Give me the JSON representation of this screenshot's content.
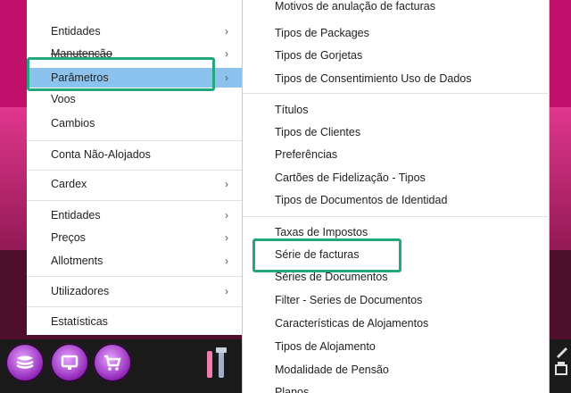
{
  "left_menu": {
    "items": [
      {
        "label": "Entidades",
        "submenu": true
      },
      {
        "label": "Manutenção",
        "submenu": true
      },
      {
        "label": "Parâmetros",
        "submenu": true,
        "selected": true
      },
      {
        "label": "Voos",
        "submenu": false
      },
      {
        "label": "Cambios",
        "submenu": false
      },
      {
        "label": "Conta Não-Alojados",
        "submenu": false
      },
      {
        "label": "Cardex",
        "submenu": true
      },
      {
        "label": "Entidades",
        "submenu": true
      },
      {
        "label": "Preços",
        "submenu": true
      },
      {
        "label": "Allotments",
        "submenu": true
      },
      {
        "label": "Utilizadores",
        "submenu": true
      },
      {
        "label": "Estatísticas",
        "submenu": false
      }
    ],
    "arrow_glyph": "›"
  },
  "right_menu": {
    "items": [
      {
        "label": "Motivos de anulação de facturas"
      },
      {
        "label": "Tipos de Packages"
      },
      {
        "label": "Tipos de Gorjetas"
      },
      {
        "label": "Tipos de Consentimiento Uso de Dados"
      },
      {
        "label": "Títulos"
      },
      {
        "label": "Tipos de Clientes"
      },
      {
        "label": "Preferências"
      },
      {
        "label": "Cartões de Fidelização - Tipos"
      },
      {
        "label": "Tipos de Documentos de Identidad"
      },
      {
        "label": "Taxas de Impostos"
      },
      {
        "label": "Série de facturas",
        "highlighted": true
      },
      {
        "label": "Séries de Documentos"
      },
      {
        "label": "Filter - Series de Documentos"
      },
      {
        "label": "Características de Alojamentos"
      },
      {
        "label": "Tipos de Alojamento"
      },
      {
        "label": "Modalidade de Pensão"
      },
      {
        "label": "Planos"
      }
    ]
  },
  "toolbar": {
    "icons": [
      "stack-icon",
      "monitor-icon",
      "cart-icon",
      "tools-icon"
    ]
  },
  "colors": {
    "selection": "#8cc2ee",
    "highlight_box": "#22a87a",
    "background": "#c0106c"
  }
}
